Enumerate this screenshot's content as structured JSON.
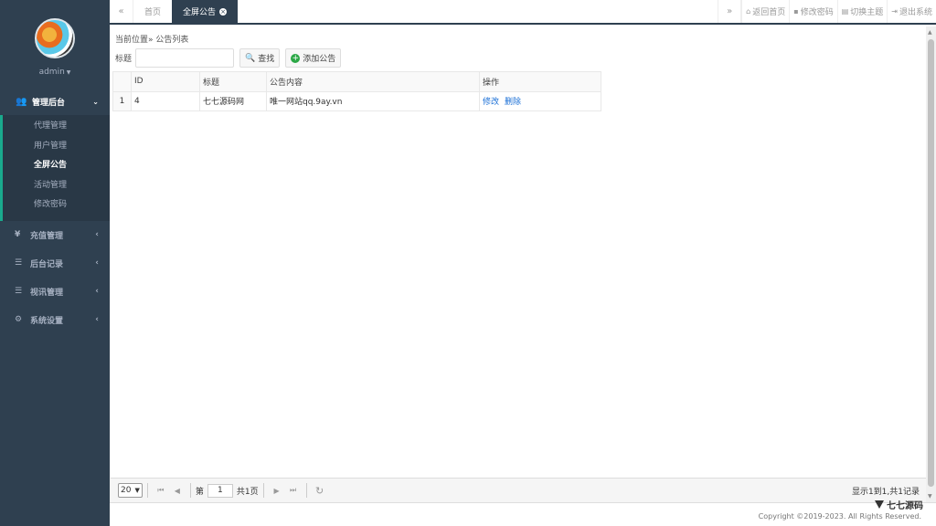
{
  "sidebar": {
    "user": "admin",
    "group": {
      "label": "管理后台",
      "items": [
        "代理管理",
        "用户管理",
        "全屏公告",
        "活动管理",
        "修改密码"
      ],
      "active_index": 2
    },
    "menu": [
      {
        "icon": "yen-icon",
        "glyph": "¥",
        "label": "充值管理"
      },
      {
        "icon": "list-icon",
        "glyph": "☰",
        "label": "后台记录"
      },
      {
        "icon": "indent-icon",
        "glyph": "☰",
        "label": "视讯管理"
      },
      {
        "icon": "cogs-icon",
        "glyph": "⚙",
        "label": "系统设置"
      }
    ]
  },
  "topbar": {
    "prev": "«",
    "next": "»",
    "tabs": [
      {
        "label": "首页",
        "active": false
      },
      {
        "label": "全屏公告",
        "active": true
      }
    ],
    "actions": [
      {
        "icon": "home-icon",
        "glyph": "⌂",
        "label": "返回首页"
      },
      {
        "icon": "lock-icon",
        "glyph": "▪",
        "label": "修改密码"
      },
      {
        "icon": "theme-icon",
        "glyph": "▤",
        "label": "切换主题"
      },
      {
        "icon": "signout-icon",
        "glyph": "⇥",
        "label": "退出系统"
      }
    ]
  },
  "main": {
    "breadcrumb": "当前位置» 公告列表",
    "search": {
      "label": "标题",
      "value": "",
      "search_btn": "查找",
      "add_btn": "添加公告"
    },
    "table": {
      "columns": [
        "",
        "ID",
        "标题",
        "公告内容",
        "操作"
      ],
      "rows": [
        {
          "num": "1",
          "id": "4",
          "title": "七七源码网",
          "content": "唯一网站qq.9ay.vn",
          "edit": "修改",
          "del": "删除"
        }
      ]
    },
    "pager": {
      "page_size": "20",
      "page_prefix": "第",
      "page": "1",
      "page_suffix": "共1页",
      "info": "显示1到1,共1记录"
    }
  },
  "footer": {
    "copyright": "Copyright ©2019-2023. All Rights Reserved.",
    "watermark": "七七源码"
  }
}
